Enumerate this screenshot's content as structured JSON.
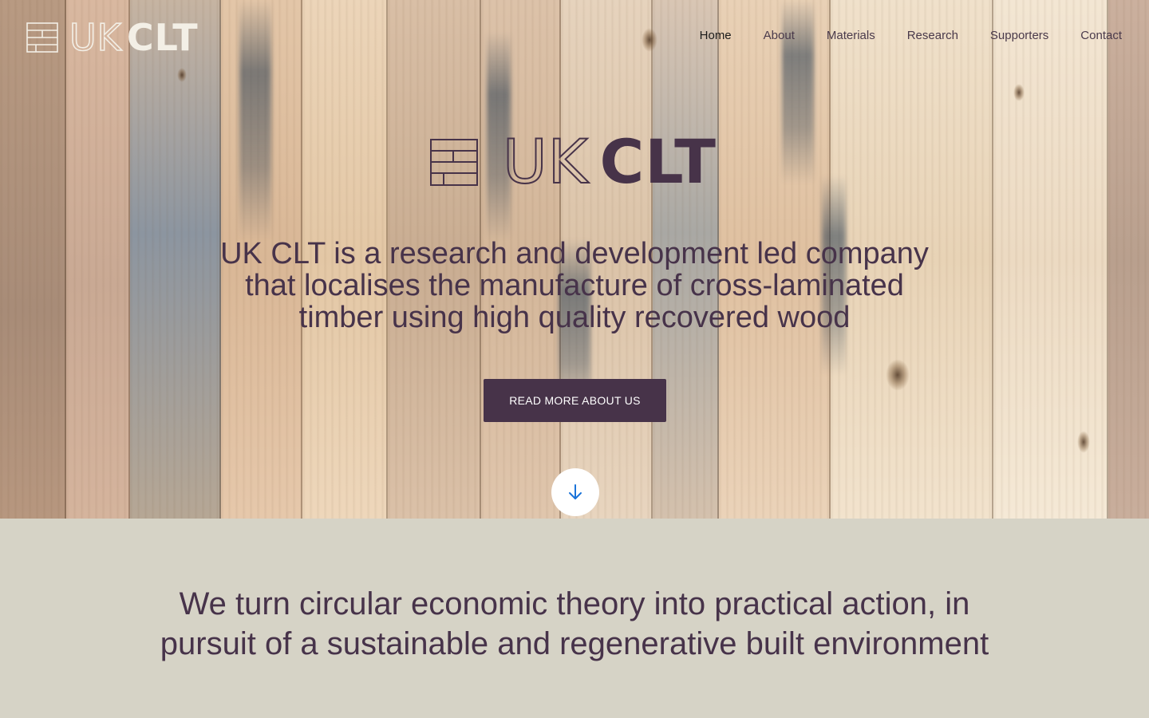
{
  "brand": {
    "logo_icon": "stacked-timber-layers-icon",
    "logo_uk": "UK",
    "logo_clt": "CLT"
  },
  "nav": {
    "items": [
      {
        "label": "Home",
        "active": true
      },
      {
        "label": "About",
        "active": false
      },
      {
        "label": "Materials",
        "active": false
      },
      {
        "label": "Research",
        "active": false
      },
      {
        "label": "Supporters",
        "active": false
      },
      {
        "label": "Contact",
        "active": false
      }
    ]
  },
  "hero": {
    "tagline_lines": [
      "UK CLT is a research and development led company",
      "that localises the manufacture of cross-laminated",
      "timber using high quality recovered wood"
    ],
    "cta_label": "READ MORE ABOUT US",
    "scroll_icon": "arrow-down-icon"
  },
  "mission": {
    "lines": [
      "We turn circular economic theory into practical action, in",
      "pursuit of a sustainable and regenerative built environment"
    ]
  },
  "colors": {
    "primary": "#473349",
    "section_bg": "#d6d3c6",
    "scroll_arrow": "#1a73d9",
    "nav_logo": "#f3efe6"
  }
}
